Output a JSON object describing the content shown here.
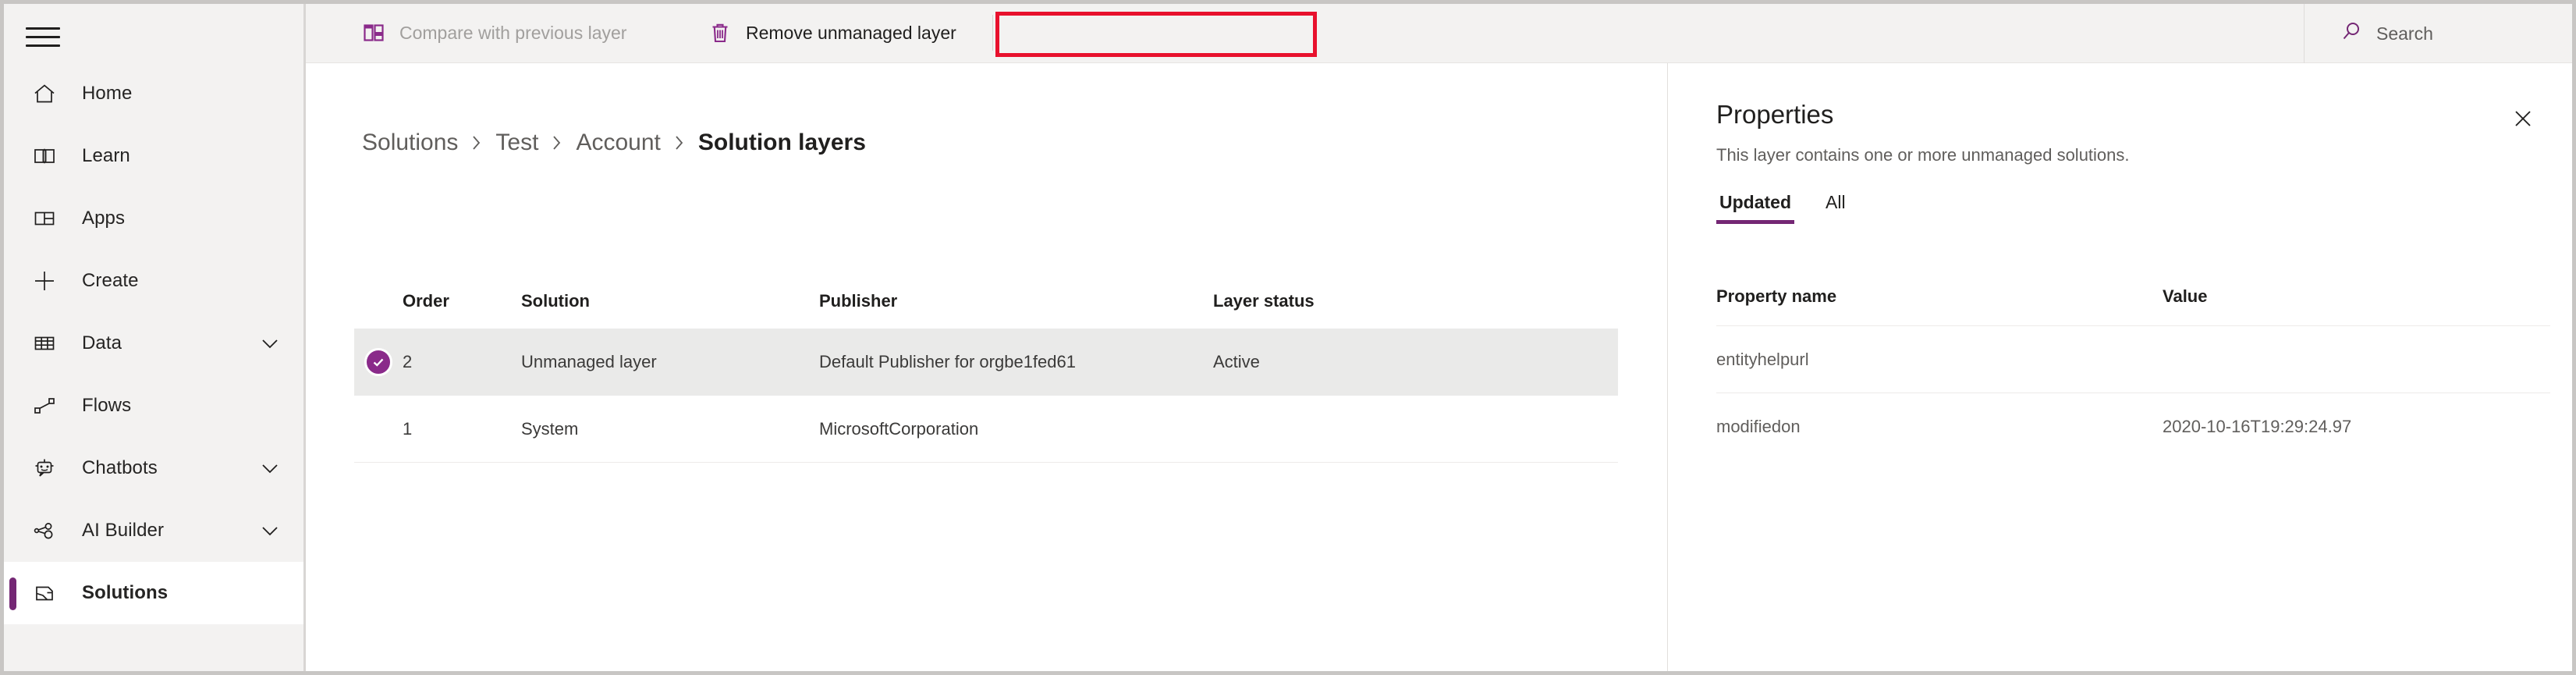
{
  "colors": {
    "brand_purple": "#742774",
    "check_purple": "#8a2a8a",
    "annotation_red": "#e8112d",
    "chrome_gray": "#f3f2f1",
    "selected_row": "#eaeae9"
  },
  "sidebar": {
    "menu_button": "menu",
    "items": [
      {
        "label": "Home",
        "icon": "home-icon",
        "expandable": false,
        "active": false
      },
      {
        "label": "Learn",
        "icon": "book-icon",
        "expandable": false,
        "active": false
      },
      {
        "label": "Apps",
        "icon": "apps-grid-icon",
        "expandable": false,
        "active": false
      },
      {
        "label": "Create",
        "icon": "plus-icon",
        "expandable": false,
        "active": false
      },
      {
        "label": "Data",
        "icon": "table-icon",
        "expandable": true,
        "active": false
      },
      {
        "label": "Flows",
        "icon": "flow-icon",
        "expandable": false,
        "active": false
      },
      {
        "label": "Chatbots",
        "icon": "robot-icon",
        "expandable": true,
        "active": false
      },
      {
        "label": "AI Builder",
        "icon": "ai-nodes-icon",
        "expandable": true,
        "active": false
      },
      {
        "label": "Solutions",
        "icon": "solutions-icon",
        "expandable": false,
        "active": true
      }
    ]
  },
  "commandbar": {
    "compare_label": "Compare with previous layer",
    "compare_icon": "compare-layers-icon",
    "compare_disabled": true,
    "remove_label": "Remove unmanaged layer",
    "remove_icon": "trash-icon",
    "remove_highlighted": true,
    "search_label": "Search",
    "search_icon": "search-icon"
  },
  "main": {
    "breadcrumb": [
      {
        "label": "Solutions",
        "current": false
      },
      {
        "label": "Test",
        "current": false
      },
      {
        "label": "Account",
        "current": false
      },
      {
        "label": "Solution layers",
        "current": true
      }
    ],
    "table": {
      "columns": [
        "Order",
        "Solution",
        "Publisher",
        "Layer status"
      ],
      "rows": [
        {
          "selected": true,
          "order": "2",
          "solution": "Unmanaged layer",
          "publisher": "Default Publisher for orgbe1fed61",
          "layer_status": "Active"
        },
        {
          "selected": false,
          "order": "1",
          "solution": "System",
          "publisher": "MicrosoftCorporation",
          "layer_status": ""
        }
      ]
    }
  },
  "properties": {
    "title": "Properties",
    "subtitle": "This layer contains one or more unmanaged solutions.",
    "close_icon": "close-icon",
    "tabs": [
      {
        "label": "Updated",
        "active": true
      },
      {
        "label": "All",
        "active": false
      }
    ],
    "table": {
      "columns": [
        "Property name",
        "Value"
      ],
      "rows": [
        {
          "name": "entityhelpurl",
          "value": ""
        },
        {
          "name": "modifiedon",
          "value": "2020-10-16T19:29:24.97"
        }
      ]
    }
  }
}
